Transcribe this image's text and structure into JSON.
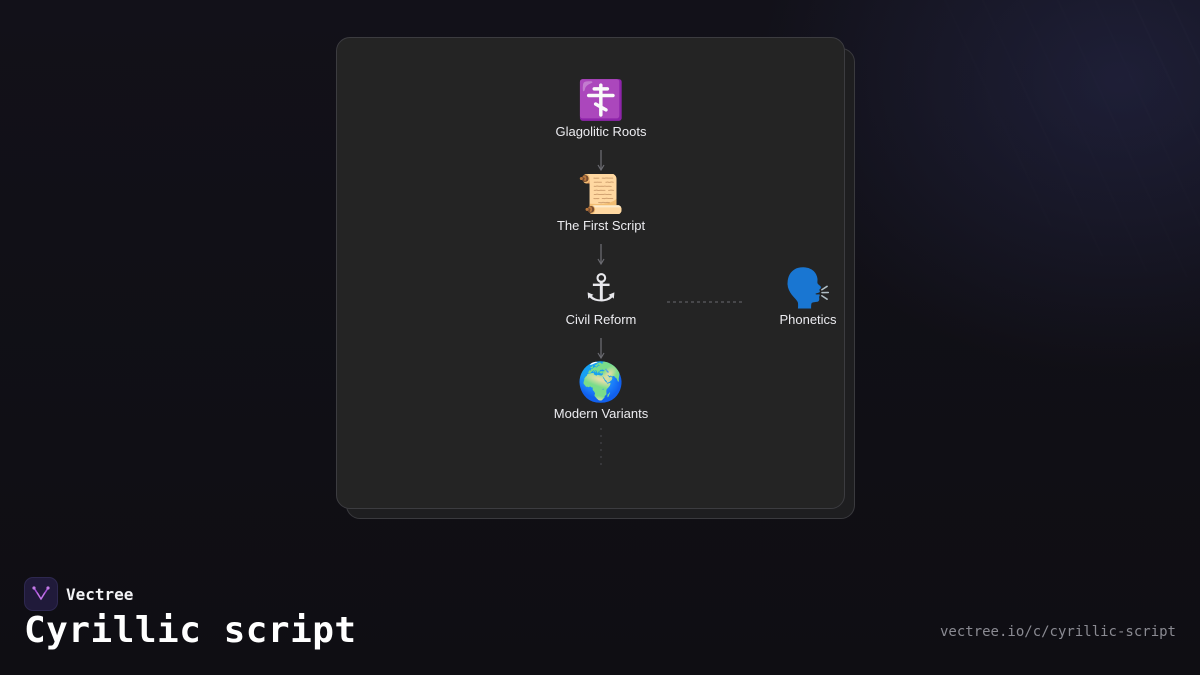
{
  "nodes": [
    {
      "id": "glagolitic-roots",
      "label": "Glagolitic Roots",
      "icon": "☦️",
      "icon_name": "orthodox-cross-icon"
    },
    {
      "id": "first-script",
      "label": "The First Script",
      "icon": "📜",
      "icon_name": "scroll-icon"
    },
    {
      "id": "civil-reform",
      "label": "Civil Reform",
      "icon": "⚓",
      "icon_name": "anchor-icon"
    },
    {
      "id": "modern-variants",
      "label": "Modern Variants",
      "icon": "🌍",
      "icon_name": "globe-icon"
    },
    {
      "id": "phonetics",
      "label": "Phonetics",
      "icon": "🗣️",
      "icon_name": "speaking-head-icon"
    }
  ],
  "edges": [
    {
      "from": "glagolitic-roots",
      "to": "first-script",
      "style": "solid"
    },
    {
      "from": "first-script",
      "to": "civil-reform",
      "style": "solid"
    },
    {
      "from": "civil-reform",
      "to": "modern-variants",
      "style": "solid"
    },
    {
      "from": "civil-reform",
      "to": "phonetics",
      "style": "dashed"
    },
    {
      "from": "modern-variants",
      "to": null,
      "style": "dotted"
    }
  ],
  "brand": {
    "name": "Vectree",
    "logo_icon": "vectree-logo-icon",
    "accent": "#a64dd8"
  },
  "page": {
    "title": "Cyrillic script",
    "url": "vectree.io/c/cyrillic-script"
  },
  "colors": {
    "card": "#242424",
    "background": "#111016",
    "edge": "#6a6a70"
  }
}
